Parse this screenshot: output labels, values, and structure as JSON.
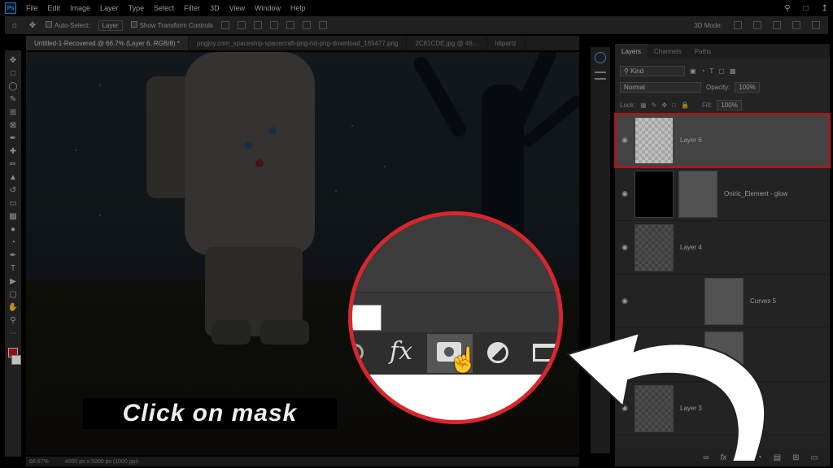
{
  "app": {
    "logo": "Ps",
    "menu": [
      "File",
      "Edit",
      "Image",
      "Layer",
      "Type",
      "Select",
      "Filter",
      "3D",
      "View",
      "Window",
      "Help"
    ]
  },
  "options_bar": {
    "auto_select_label": "Auto-Select:",
    "auto_select_value": "Layer",
    "transform_controls_label": "Show Transform Controls",
    "mode_3d_label": "3D Mode:"
  },
  "document_tabs": [
    "Untitled-1-Recovered @ 66.7% (Layer 6, RGB/8) *",
    "pngjoy.com_spaceship-spacecraft-png-hd-png-download_165477.png",
    "2C81CDE.jpg @ 46...",
    "Idipartz"
  ],
  "status": {
    "zoom": "66.67%",
    "doc_size": "4000 px x 5000 px (1000 ppi)"
  },
  "caption": "Click on mask",
  "layers_panel": {
    "tabs": [
      "Layers",
      "Channels",
      "Paths"
    ],
    "kind_filter": "Kind",
    "blend_mode": "Normal",
    "opacity_label": "Opacity:",
    "opacity_value": "100%",
    "lock_label": "Lock:",
    "fill_label": "Fill:",
    "fill_value": "100%",
    "layers": [
      {
        "name": "Layer 6",
        "selected": true
      },
      {
        "name": "Oniric_Element - glow",
        "selected": false
      },
      {
        "name": "Layer 4",
        "selected": false
      },
      {
        "name": "Curves 5",
        "selected": false
      },
      {
        "name": "",
        "selected": false
      },
      {
        "name": "Layer 3",
        "selected": false
      }
    ],
    "bottom_icons": [
      "link-icon",
      "fx-icon",
      "mask-icon",
      "adjustment-icon",
      "folder-icon",
      "new-layer-icon",
      "trash-icon"
    ]
  },
  "magnifier": {
    "fx_label": "fx"
  },
  "colors": {
    "highlight_red": "#d8262c",
    "foreground_swatch": "#c0191e",
    "background_swatch": "#ffffff"
  }
}
